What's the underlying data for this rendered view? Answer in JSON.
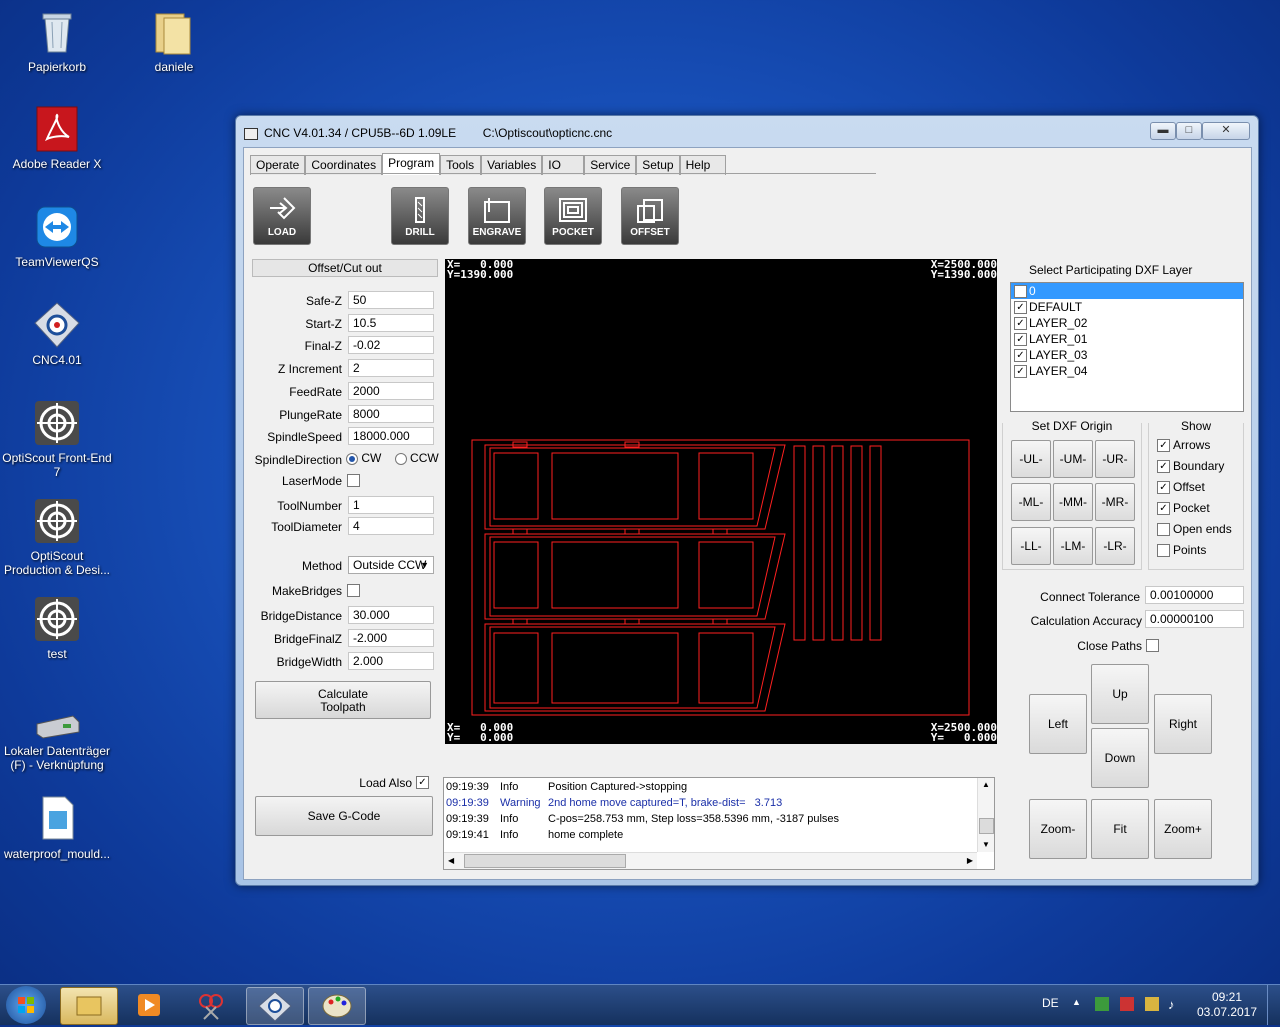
{
  "desktop": {
    "icons": [
      {
        "label": "Papierkorb"
      },
      {
        "label": "daniele"
      },
      {
        "label": "Adobe Reader X"
      },
      {
        "label": "TeamViewerQS"
      },
      {
        "label": "CNC4.01"
      },
      {
        "label": "OptiScout Front-End 7"
      },
      {
        "label": "OptiScout Production & Desi..."
      },
      {
        "label": "test"
      },
      {
        "label": "Lokaler Datenträger (F) - Verknüpfung"
      },
      {
        "label": "waterproof_mould..."
      }
    ]
  },
  "window": {
    "title": "CNC V4.01.34 / CPU5B--6D 1.09LE        C:\\Optiscout\\opticnc.cnc",
    "controls": {
      "minimize": "▬",
      "maximize": "□",
      "close": "✕"
    },
    "tabs": [
      "Operate",
      "Coordinates",
      "Program",
      "Tools",
      "Variables",
      "IO",
      "Service",
      "Setup",
      "Help"
    ],
    "active_tab": "Program"
  },
  "toolbar": {
    "load": "LOAD",
    "drill": "DRILL",
    "engrave": "ENGRAVE",
    "pocket": "POCKET",
    "offset": "OFFSET"
  },
  "form": {
    "title": "Offset/Cut out",
    "safe_z": {
      "label": "Safe-Z",
      "value": "50"
    },
    "start_z": {
      "label": "Start-Z",
      "value": "10.5"
    },
    "final_z": {
      "label": "Final-Z",
      "value": "-0.02"
    },
    "z_increment": {
      "label": "Z Increment",
      "value": "2"
    },
    "feedrate": {
      "label": "FeedRate",
      "value": "2000"
    },
    "plungerate": {
      "label": "PlungeRate",
      "value": "8000"
    },
    "spindlespeed": {
      "label": "SpindleSpeed",
      "value": "18000.000"
    },
    "spindle_direction": {
      "label": "SpindleDirection",
      "cw": "CW",
      "ccw": "CCW",
      "selected": "CW"
    },
    "lasermode": {
      "label": "LaserMode",
      "checked": false
    },
    "toolnumber": {
      "label": "ToolNumber",
      "value": "1"
    },
    "tooldiameter": {
      "label": "ToolDiameter",
      "value": "4"
    },
    "method": {
      "label": "Method",
      "value": "Outside CCW"
    },
    "makebridges": {
      "label": "MakeBridges",
      "checked": false
    },
    "bridgedistance": {
      "label": "BridgeDistance",
      "value": "30.000"
    },
    "bridgefinalz": {
      "label": "BridgeFinalZ",
      "value": "-2.000"
    },
    "bridgewidth": {
      "label": "BridgeWidth",
      "value": "2.000"
    },
    "calculate_line1": "Calculate",
    "calculate_line2": "Toolpath",
    "load_also": {
      "label": "Load Also",
      "checked": true
    },
    "save_gcode": "Save G-Code"
  },
  "canvas": {
    "top_left": "X=   0.000\nY=1390.000",
    "top_right": "X=2500.000\nY=1390.000",
    "bottom_left": "X=   0.000\nY=   0.000",
    "bottom_right": "X=2500.000\nY=   0.000",
    "line_color": "#ff2020"
  },
  "layers": {
    "title": "Select Participating DXF Layer",
    "items": [
      {
        "name": "0",
        "checked": true,
        "selected": true
      },
      {
        "name": "DEFAULT",
        "checked": true
      },
      {
        "name": "LAYER_02",
        "checked": true
      },
      {
        "name": "LAYER_01",
        "checked": true
      },
      {
        "name": "LAYER_03",
        "checked": true
      },
      {
        "name": "LAYER_04",
        "checked": true
      }
    ]
  },
  "origin": {
    "title": "Set DXF Origin",
    "buttons": [
      "-UL-",
      "-UM-",
      "-UR-",
      "-ML-",
      "-MM-",
      "-MR-",
      "-LL-",
      "-LM-",
      "-LR-"
    ]
  },
  "show": {
    "title": "Show",
    "items": [
      {
        "label": "Arrows",
        "checked": true
      },
      {
        "label": "Boundary",
        "checked": true
      },
      {
        "label": "Offset",
        "checked": true
      },
      {
        "label": "Pocket",
        "checked": true
      },
      {
        "label": "Open ends",
        "checked": false
      },
      {
        "label": "Points",
        "checked": false
      }
    ]
  },
  "tolerance": {
    "connect_label": "Connect Tolerance",
    "connect_value": "0.00100000",
    "accuracy_label": "Calculation Accuracy",
    "accuracy_value": "0.00000100",
    "close_paths": "Close Paths"
  },
  "nav": {
    "up": "Up",
    "left": "Left",
    "right": "Right",
    "down": "Down",
    "zoom_minus": "Zoom-",
    "fit": "Fit",
    "zoom_plus": "Zoom+"
  },
  "log": {
    "rows": [
      {
        "time": "09:19:39",
        "level": "Info",
        "msg": "Position Captured->stopping",
        "color": "#000000"
      },
      {
        "time": "09:19:39",
        "level": "Warning",
        "msg": "2nd home move captured=T, brake-dist=   3.713",
        "color": "#1a2fa8"
      },
      {
        "time": "09:19:39",
        "level": "Info",
        "msg": "C-pos=258.753 mm, Step loss=358.5396 mm, -3187 pulses",
        "color": "#000000"
      },
      {
        "time": "09:19:41",
        "level": "Info",
        "msg": "home complete",
        "color": "#000000"
      }
    ]
  },
  "taskbar": {
    "lang": "DE",
    "time": "09:21",
    "date": "03.07.2017"
  }
}
